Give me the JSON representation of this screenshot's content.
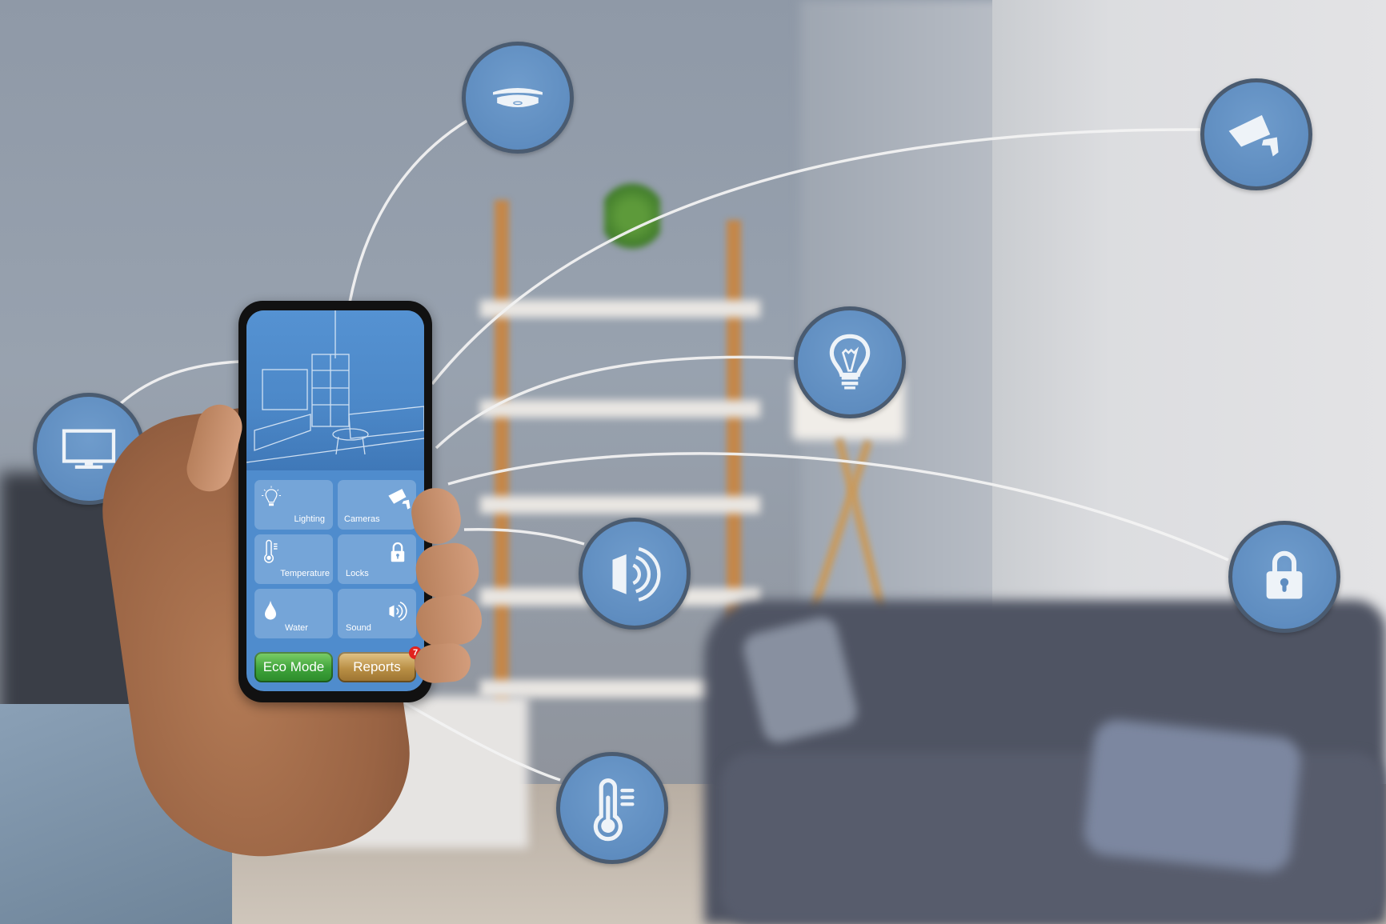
{
  "scene": {
    "description": "Hand holding smartphone with smart home control app in a living room, connected to floating device icons",
    "accent_color": "#5f8dc0",
    "icon_border_color": "#4a5b70"
  },
  "phone_app": {
    "tiles": [
      {
        "label": "Lighting",
        "icon": "lightbulb-icon"
      },
      {
        "label": "Cameras",
        "icon": "security-camera-icon"
      },
      {
        "label": "Temperature",
        "icon": "thermometer-icon"
      },
      {
        "label": "Locks",
        "icon": "padlock-icon"
      },
      {
        "label": "Water",
        "icon": "water-drop-icon"
      },
      {
        "label": "Sound",
        "icon": "speaker-icon"
      }
    ],
    "buttons": {
      "eco_mode": "Eco Mode",
      "reports": "Reports",
      "reports_badge": "7"
    }
  },
  "floating_icons": [
    {
      "name": "smoke-detector",
      "icon": "smoke-detector-icon"
    },
    {
      "name": "security-camera",
      "icon": "security-camera-icon"
    },
    {
      "name": "tv",
      "icon": "tv-icon"
    },
    {
      "name": "lightbulb",
      "icon": "lightbulb-icon"
    },
    {
      "name": "speaker",
      "icon": "speaker-icon"
    },
    {
      "name": "lock",
      "icon": "padlock-icon"
    },
    {
      "name": "thermometer",
      "icon": "thermometer-icon"
    }
  ]
}
